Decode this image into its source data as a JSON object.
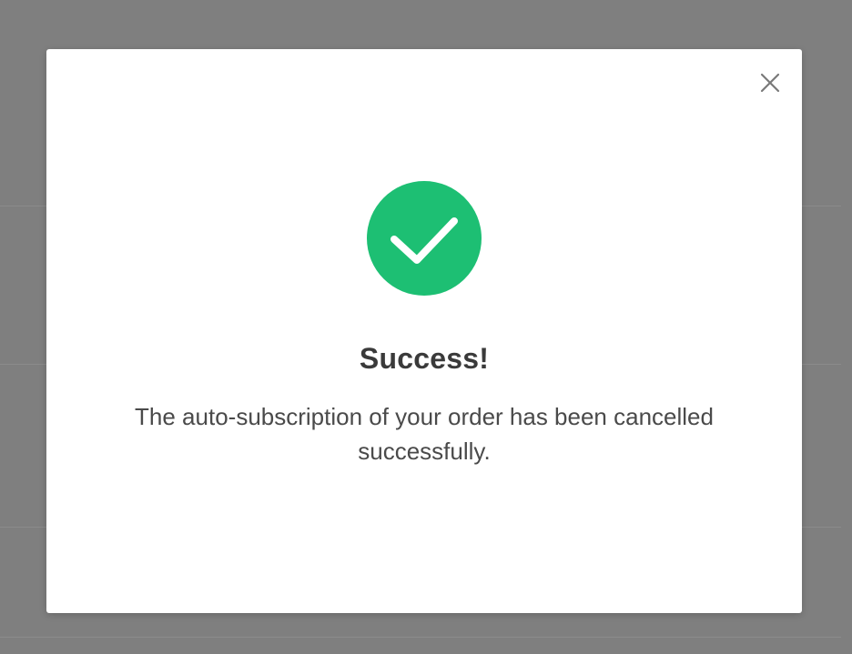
{
  "modal": {
    "close_icon": "close-icon",
    "status_icon": "check-icon",
    "accent_color": "#1dbf73",
    "title": "Success!",
    "message": "The auto-subscription of your order has been cancelled successfully."
  }
}
